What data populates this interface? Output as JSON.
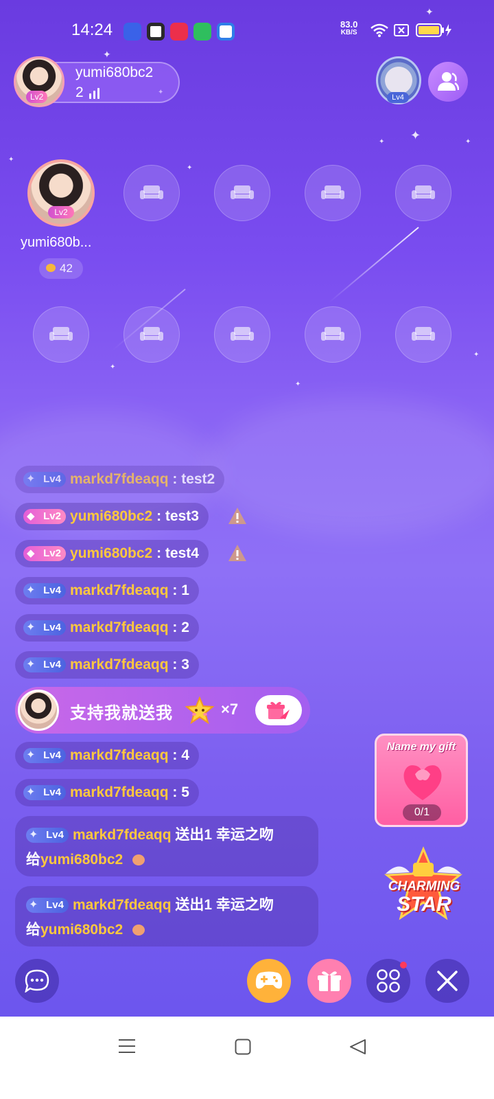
{
  "status_bar": {
    "time": "14:24",
    "net_speed_value": "83.0",
    "net_speed_unit": "KB/S",
    "icons": [
      "baidu-icon",
      "app-icon",
      "video-icon",
      "shield-icon",
      "browser-icon",
      "wifi-icon",
      "sim-icon",
      "battery-icon"
    ]
  },
  "header": {
    "host_name": "yumi680bc2",
    "host_level": "Lv2",
    "online_count": "2",
    "rank_level": "Lv4"
  },
  "seats": {
    "occupied_name": "yumi680b...",
    "occupied_level": "Lv2",
    "occupied_score": "42"
  },
  "chat": {
    "messages": [
      {
        "level": "Lv4",
        "user": "markd7fdeaqq",
        "text": " : test2"
      },
      {
        "level": "Lv2",
        "user": "yumi680bc2",
        "text": " : test3"
      },
      {
        "level": "Lv2",
        "user": "yumi680bc2",
        "text": " : test4"
      },
      {
        "level": "Lv4",
        "user": "markd7fdeaqq",
        "text": " : 1"
      },
      {
        "level": "Lv4",
        "user": "markd7fdeaqq",
        "text": " : 2"
      },
      {
        "level": "Lv4",
        "user": "markd7fdeaqq",
        "text": " : 3"
      },
      {
        "level": "Lv4",
        "user": "markd7fdeaqq",
        "text": " : 4"
      },
      {
        "level": "Lv4",
        "user": "markd7fdeaqq",
        "text": " : 5"
      }
    ],
    "support_banner": {
      "text": "支持我就送我",
      "count": "×7"
    },
    "gift_messages": [
      {
        "level": "Lv4",
        "user": "markd7fdeaqq",
        "action": " 送出1 幸运之吻",
        "to_prefix": "给",
        "to_user": "yumi680bc2"
      },
      {
        "level": "Lv4",
        "user": "markd7fdeaqq",
        "action": " 送出1 幸运之吻",
        "to_prefix": "给",
        "to_user": "yumi680bc2"
      }
    ]
  },
  "widgets": {
    "name_gift_title": "Name my gift",
    "name_gift_progress": "0/1",
    "charming_line1": "CHARMING",
    "charming_line2": "STAR"
  },
  "colors": {
    "background_top": "#6a3be0",
    "background_bottom": "#6b55ee",
    "username": "#ffc83d",
    "game_button": "#ffb23a",
    "gift_button": "#ff7fb0"
  }
}
